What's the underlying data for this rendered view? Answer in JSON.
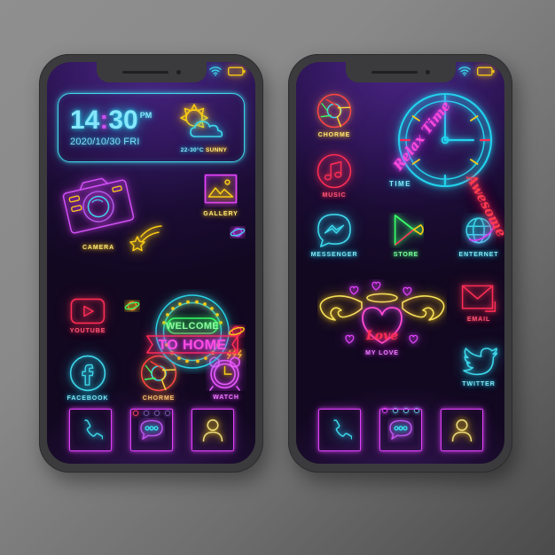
{
  "theme": {
    "page_background": "#8a8a8a",
    "phone_frame": "#3b3b3d",
    "screen_top": "#4a2585",
    "screen_bottom": "#120820",
    "accent_cyan": "#22d3ee",
    "accent_magenta": "#e040fb",
    "accent_yellow": "#facc15",
    "accent_red": "#ff2d55",
    "accent_green": "#39ff6a"
  },
  "phone_left": {
    "name": "Home Screen 1",
    "status_bar": {
      "wifi_icon": "wifi-icon",
      "battery_icon": "battery-icon"
    },
    "widget": {
      "time": "14:30",
      "hours": "14",
      "colon": ":",
      "minutes": "30",
      "ampm": "PM",
      "date": "2020/10/30 FRI",
      "weather_icon": "sun-behind-cloud-icon",
      "temperature": "22-30°C",
      "condition": "SUNNY"
    },
    "apps": [
      {
        "label": "CAMERA",
        "icon": "camera-icon",
        "color": "m"
      },
      {
        "label": "GALLERY",
        "icon": "gallery-icon",
        "color": "y"
      },
      {
        "label": "YOUTUBE",
        "icon": "youtube-icon",
        "color": "r"
      },
      {
        "label": "FACEBOOK",
        "icon": "facebook-icon",
        "color": "c"
      },
      {
        "label": "CHORME",
        "icon": "chrome-icon",
        "color": "o"
      },
      {
        "label": "WATCH",
        "icon": "alarm-clock-icon",
        "color": "m"
      }
    ],
    "badge": {
      "top_text": "WELCOME",
      "ribbon_text": "TO HOME",
      "shooting_star_icon": "shooting-star-icon",
      "planet_icon": "planet-icon"
    },
    "page_dots": {
      "count": 4,
      "active_index": 0
    },
    "dock": [
      {
        "label": "phone",
        "icon": "phone-icon"
      },
      {
        "label": "messages",
        "icon": "chat-bubble-icon"
      },
      {
        "label": "contacts",
        "icon": "person-icon"
      }
    ]
  },
  "phone_right": {
    "name": "Home Screen 2",
    "status_bar": {
      "wifi_icon": "wifi-icon",
      "battery_icon": "battery-icon"
    },
    "clock_widget": {
      "script_left": "Relax Time",
      "script_right": "Awesome",
      "label": "TIME",
      "icon": "analog-clock-icon"
    },
    "apps": [
      {
        "label": "CHORME",
        "icon": "chrome-icon",
        "color": "o"
      },
      {
        "label": "MUSIC",
        "icon": "music-note-icon",
        "color": "r"
      },
      {
        "label": "MESSENGER",
        "icon": "messenger-icon",
        "color": "c"
      },
      {
        "label": "STORE",
        "icon": "play-store-icon",
        "color": "g"
      },
      {
        "label": "ENTERNET",
        "icon": "globe-icon",
        "color": "c"
      },
      {
        "label": "MY LOVE",
        "icon": "winged-heart-icon",
        "color": "m"
      },
      {
        "label": "EMAIL",
        "icon": "envelope-icon",
        "color": "r"
      },
      {
        "label": "TWITTER",
        "icon": "twitter-bird-icon",
        "color": "c"
      }
    ],
    "love_widget": {
      "text": "Love",
      "label": "MY LOVE"
    },
    "page_dots": {
      "count": 4,
      "active_index": 0
    },
    "dock": [
      {
        "label": "phone",
        "icon": "phone-icon"
      },
      {
        "label": "messages",
        "icon": "chat-bubble-icon"
      },
      {
        "label": "contacts",
        "icon": "person-icon"
      }
    ]
  }
}
